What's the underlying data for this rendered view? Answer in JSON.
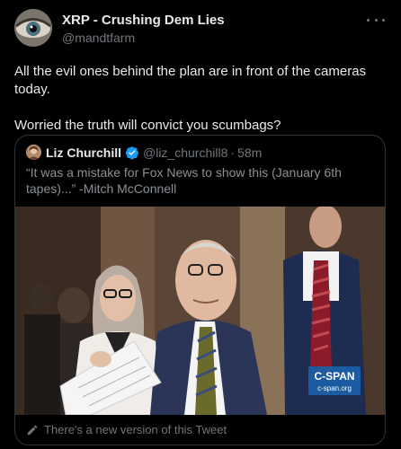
{
  "author": {
    "name": "XRP - Crushing Dem Lies",
    "handle": "@mandtfarm",
    "avatar_icon": "eye-icon"
  },
  "menu": {
    "icon": "more-horizontal-icon"
  },
  "tweet": {
    "paragraphs": [
      "All the evil ones behind the plan are in front of the cameras today.",
      "Worried the truth will convict you scumbags?"
    ]
  },
  "quote": {
    "name": "Liz Churchill",
    "handle": "@liz_churchill8",
    "separator": "·",
    "time": "58m",
    "text": "“It was a mistake for Fox News to show this (January 6th tapes)...” -Mitch McConnell",
    "verified_icon": "verified-badge-icon",
    "verified_color": "#1d9bf0",
    "media": {
      "watermark_brand": "C-SPAN",
      "watermark_url": "c-span.org",
      "watermark_color": "#1a5fa8"
    }
  },
  "footer": {
    "new_version_text": "There's a new version of this Tweet",
    "icon": "pencil-icon"
  }
}
